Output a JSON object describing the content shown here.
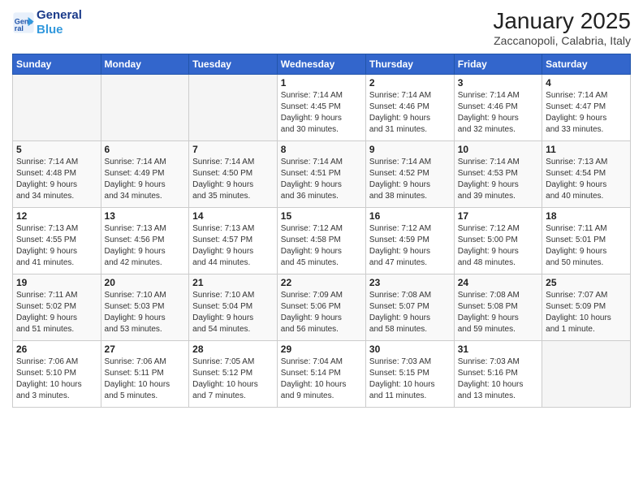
{
  "header": {
    "logo_line1": "General",
    "logo_line2": "Blue",
    "month": "January 2025",
    "location": "Zaccanopoli, Calabria, Italy"
  },
  "weekdays": [
    "Sunday",
    "Monday",
    "Tuesday",
    "Wednesday",
    "Thursday",
    "Friday",
    "Saturday"
  ],
  "weeks": [
    [
      {
        "day": "",
        "info": ""
      },
      {
        "day": "",
        "info": ""
      },
      {
        "day": "",
        "info": ""
      },
      {
        "day": "1",
        "info": "Sunrise: 7:14 AM\nSunset: 4:45 PM\nDaylight: 9 hours\nand 30 minutes."
      },
      {
        "day": "2",
        "info": "Sunrise: 7:14 AM\nSunset: 4:46 PM\nDaylight: 9 hours\nand 31 minutes."
      },
      {
        "day": "3",
        "info": "Sunrise: 7:14 AM\nSunset: 4:46 PM\nDaylight: 9 hours\nand 32 minutes."
      },
      {
        "day": "4",
        "info": "Sunrise: 7:14 AM\nSunset: 4:47 PM\nDaylight: 9 hours\nand 33 minutes."
      }
    ],
    [
      {
        "day": "5",
        "info": "Sunrise: 7:14 AM\nSunset: 4:48 PM\nDaylight: 9 hours\nand 34 minutes."
      },
      {
        "day": "6",
        "info": "Sunrise: 7:14 AM\nSunset: 4:49 PM\nDaylight: 9 hours\nand 34 minutes."
      },
      {
        "day": "7",
        "info": "Sunrise: 7:14 AM\nSunset: 4:50 PM\nDaylight: 9 hours\nand 35 minutes."
      },
      {
        "day": "8",
        "info": "Sunrise: 7:14 AM\nSunset: 4:51 PM\nDaylight: 9 hours\nand 36 minutes."
      },
      {
        "day": "9",
        "info": "Sunrise: 7:14 AM\nSunset: 4:52 PM\nDaylight: 9 hours\nand 38 minutes."
      },
      {
        "day": "10",
        "info": "Sunrise: 7:14 AM\nSunset: 4:53 PM\nDaylight: 9 hours\nand 39 minutes."
      },
      {
        "day": "11",
        "info": "Sunrise: 7:13 AM\nSunset: 4:54 PM\nDaylight: 9 hours\nand 40 minutes."
      }
    ],
    [
      {
        "day": "12",
        "info": "Sunrise: 7:13 AM\nSunset: 4:55 PM\nDaylight: 9 hours\nand 41 minutes."
      },
      {
        "day": "13",
        "info": "Sunrise: 7:13 AM\nSunset: 4:56 PM\nDaylight: 9 hours\nand 42 minutes."
      },
      {
        "day": "14",
        "info": "Sunrise: 7:13 AM\nSunset: 4:57 PM\nDaylight: 9 hours\nand 44 minutes."
      },
      {
        "day": "15",
        "info": "Sunrise: 7:12 AM\nSunset: 4:58 PM\nDaylight: 9 hours\nand 45 minutes."
      },
      {
        "day": "16",
        "info": "Sunrise: 7:12 AM\nSunset: 4:59 PM\nDaylight: 9 hours\nand 47 minutes."
      },
      {
        "day": "17",
        "info": "Sunrise: 7:12 AM\nSunset: 5:00 PM\nDaylight: 9 hours\nand 48 minutes."
      },
      {
        "day": "18",
        "info": "Sunrise: 7:11 AM\nSunset: 5:01 PM\nDaylight: 9 hours\nand 50 minutes."
      }
    ],
    [
      {
        "day": "19",
        "info": "Sunrise: 7:11 AM\nSunset: 5:02 PM\nDaylight: 9 hours\nand 51 minutes."
      },
      {
        "day": "20",
        "info": "Sunrise: 7:10 AM\nSunset: 5:03 PM\nDaylight: 9 hours\nand 53 minutes."
      },
      {
        "day": "21",
        "info": "Sunrise: 7:10 AM\nSunset: 5:04 PM\nDaylight: 9 hours\nand 54 minutes."
      },
      {
        "day": "22",
        "info": "Sunrise: 7:09 AM\nSunset: 5:06 PM\nDaylight: 9 hours\nand 56 minutes."
      },
      {
        "day": "23",
        "info": "Sunrise: 7:08 AM\nSunset: 5:07 PM\nDaylight: 9 hours\nand 58 minutes."
      },
      {
        "day": "24",
        "info": "Sunrise: 7:08 AM\nSunset: 5:08 PM\nDaylight: 9 hours\nand 59 minutes."
      },
      {
        "day": "25",
        "info": "Sunrise: 7:07 AM\nSunset: 5:09 PM\nDaylight: 10 hours\nand 1 minute."
      }
    ],
    [
      {
        "day": "26",
        "info": "Sunrise: 7:06 AM\nSunset: 5:10 PM\nDaylight: 10 hours\nand 3 minutes."
      },
      {
        "day": "27",
        "info": "Sunrise: 7:06 AM\nSunset: 5:11 PM\nDaylight: 10 hours\nand 5 minutes."
      },
      {
        "day": "28",
        "info": "Sunrise: 7:05 AM\nSunset: 5:12 PM\nDaylight: 10 hours\nand 7 minutes."
      },
      {
        "day": "29",
        "info": "Sunrise: 7:04 AM\nSunset: 5:14 PM\nDaylight: 10 hours\nand 9 minutes."
      },
      {
        "day": "30",
        "info": "Sunrise: 7:03 AM\nSunset: 5:15 PM\nDaylight: 10 hours\nand 11 minutes."
      },
      {
        "day": "31",
        "info": "Sunrise: 7:03 AM\nSunset: 5:16 PM\nDaylight: 10 hours\nand 13 minutes."
      },
      {
        "day": "",
        "info": ""
      }
    ]
  ]
}
